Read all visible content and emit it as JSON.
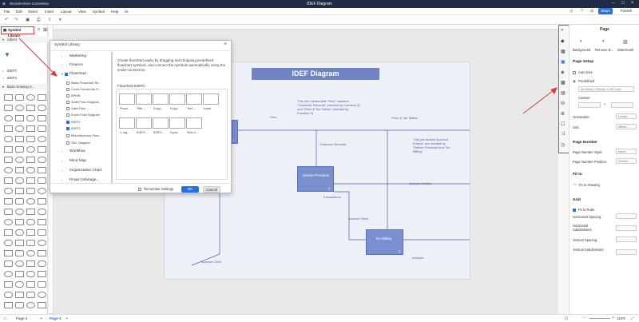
{
  "app": {
    "name": "Wondershare EdrawMax",
    "doc_title": "IDEF Diagram"
  },
  "menu": [
    "File",
    "Edit",
    "Select",
    "Insert",
    "Layout",
    "View",
    "Symbol",
    "Help"
  ],
  "menu_ai": "AI",
  "header_buttons": {
    "share": "Share",
    "publish": "Publish"
  },
  "left_panel": {
    "symbol_library": "Symbol Library",
    "collect": "collect",
    "groups": [
      "IDEF0",
      "IDEF2"
    ],
    "basic_drawing": "Basic Drawing S..."
  },
  "dialog": {
    "title": "Symbol Library",
    "categories": [
      "Marketing",
      "Finance",
      "Flowchart",
      "Workflow",
      "Mind Map",
      "Organization Chart",
      "Project Manage..."
    ],
    "flowchart_items": [
      "Basic Flowchart Sh...",
      "Cross Functional Fl...",
      "BPMN",
      "Audit Flow Diagram",
      "Data Flow",
      "Event Flow Diagram",
      "IDEF0",
      "IDEF2",
      "Miscellaneous Flow...",
      "SDL Diagram"
    ],
    "description": "Create flowchart easily by dragging and dropping predefined flowchart symbols, and connect the symbols automatically using the smart connectors.",
    "section": "Flowchart-IDEF0",
    "thumb_labels": [
      "Proce...",
      "Title ...",
      "N-typ...",
      "N-typ...",
      "Text ...",
      "Node",
      "1. leg...",
      "IDEF0...",
      "IDEF0...",
      "Dyna...",
      "Side ti..."
    ],
    "remember": "Remember Settings",
    "ok": "OK",
    "cancel": "Cancel"
  },
  "diagram": {
    "title": "IDEF Diagram",
    "box_deliver": "Deliver Products",
    "box_deliver_num": "2",
    "box_billing": "Do Billing",
    "box_billing_num": "3",
    "box_left_num": "1",
    "note_fork": "This fork means that \"Files\" contains \"Customer Records\" (needed by Function 2) and \"Price & Tax Tables\" (needed by Function 3)",
    "note_join": "This join means\"Account Entries\" are created by \"Deliver Products\"and \"Do Billing\"",
    "labels": [
      "Files",
      "Price & Tax Tables",
      "Customer Records",
      "Transactions",
      "Account Entries",
      "Account Clerk",
      "Invoices",
      "Account Clerk"
    ]
  },
  "right_panel": {
    "title": "Page",
    "tools": [
      "Background",
      "Remove B...",
      "Watermark"
    ],
    "page_setup": "Page Setup",
    "auto_size": "Auto Size",
    "predefined": "Predefined",
    "paper_size": "A4 sheet, 210mm x 297 mm",
    "custom": "Custom",
    "orientation_label": "Orientation:",
    "orientation_value": "Lands...",
    "unit_label": "Unit:",
    "unit_value": "Millim...",
    "page_number": "Page Number",
    "pn_style_label": "Page Number Style:",
    "pn_style_value": "None",
    "pn_position_label": "Page Number Position:",
    "pn_position_value": "Center",
    "fit_to": "Fit to",
    "fit_to_drawing": "Fit to Drawing",
    "grid": "Grid",
    "fit_to_ruler": "Fit to Ruler",
    "h_spacing": "Horizontal Spacing:",
    "h_subdiv": "Horizontal Subdivisions:",
    "v_spacing": "Vertical Spacing:",
    "v_subdiv": "Vertical Subdivisions:"
  },
  "status": {
    "page_tab": "Page-1",
    "page_tab_active": "Page-1",
    "zoom": "110%"
  },
  "colors": {
    "titlebar": "#1f2a44",
    "accent": "#2a6fdb",
    "highlight": "#d9403a",
    "idef_box": "#7a8fd0",
    "idef_text": "#4a5ea8"
  }
}
